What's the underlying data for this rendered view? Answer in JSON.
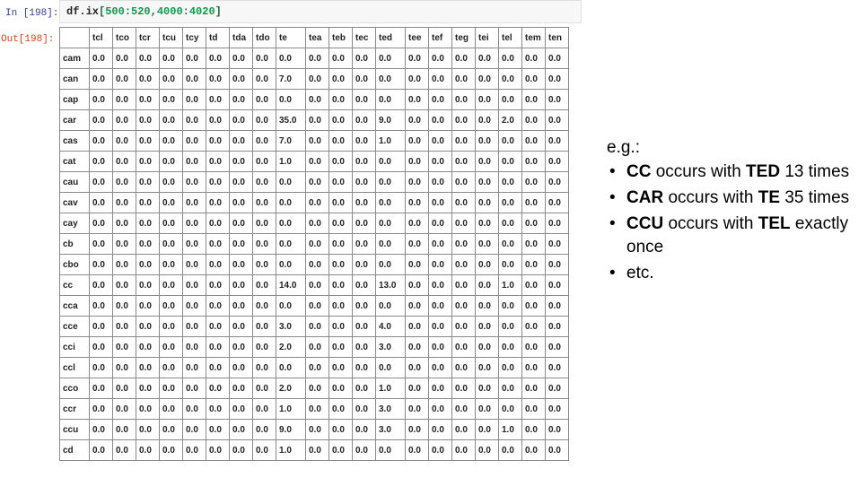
{
  "notebook": {
    "in_prompt": "In [198]:",
    "out_prompt": "Out[198]:",
    "code": {
      "object": "df.ix",
      "open_bracket": "[",
      "row_start": "500",
      "colon1": ":",
      "row_end": "520",
      "comma": ",",
      "col_start": "4000",
      "colon2": ":",
      "col_end": "4020",
      "close_bracket": "]"
    },
    "code_full": "df.ix[500:520,4000:4020]"
  },
  "table": {
    "corner_label": "",
    "columns": [
      "tcl",
      "tco",
      "tcr",
      "tcu",
      "tcy",
      "td",
      "tda",
      "tdo",
      "te",
      "tea",
      "teb",
      "tec",
      "ted",
      "tee",
      "tef",
      "teg",
      "tei",
      "tel",
      "tem",
      "ten"
    ],
    "index": [
      "cam",
      "can",
      "cap",
      "car",
      "cas",
      "cat",
      "cau",
      "cav",
      "cay",
      "cb",
      "cbo",
      "cc",
      "cca",
      "cce",
      "cci",
      "ccl",
      "cco",
      "ccr",
      "ccu",
      "cd"
    ],
    "rows": [
      {
        "index": "cam",
        "values": [
          "0.0",
          "0.0",
          "0.0",
          "0.0",
          "0.0",
          "0.0",
          "0.0",
          "0.0",
          "0.0",
          "0.0",
          "0.0",
          "0.0",
          "0.0",
          "0.0",
          "0.0",
          "0.0",
          "0.0",
          "0.0",
          "0.0",
          "0.0"
        ]
      },
      {
        "index": "can",
        "values": [
          "0.0",
          "0.0",
          "0.0",
          "0.0",
          "0.0",
          "0.0",
          "0.0",
          "0.0",
          "7.0",
          "0.0",
          "0.0",
          "0.0",
          "0.0",
          "0.0",
          "0.0",
          "0.0",
          "0.0",
          "0.0",
          "0.0",
          "0.0"
        ]
      },
      {
        "index": "cap",
        "values": [
          "0.0",
          "0.0",
          "0.0",
          "0.0",
          "0.0",
          "0.0",
          "0.0",
          "0.0",
          "0.0",
          "0.0",
          "0.0",
          "0.0",
          "0.0",
          "0.0",
          "0.0",
          "0.0",
          "0.0",
          "0.0",
          "0.0",
          "0.0"
        ]
      },
      {
        "index": "car",
        "values": [
          "0.0",
          "0.0",
          "0.0",
          "0.0",
          "0.0",
          "0.0",
          "0.0",
          "0.0",
          "35.0",
          "0.0",
          "0.0",
          "0.0",
          "9.0",
          "0.0",
          "0.0",
          "0.0",
          "0.0",
          "2.0",
          "0.0",
          "0.0"
        ]
      },
      {
        "index": "cas",
        "values": [
          "0.0",
          "0.0",
          "0.0",
          "0.0",
          "0.0",
          "0.0",
          "0.0",
          "0.0",
          "7.0",
          "0.0",
          "0.0",
          "0.0",
          "1.0",
          "0.0",
          "0.0",
          "0.0",
          "0.0",
          "0.0",
          "0.0",
          "0.0"
        ]
      },
      {
        "index": "cat",
        "values": [
          "0.0",
          "0.0",
          "0.0",
          "0.0",
          "0.0",
          "0.0",
          "0.0",
          "0.0",
          "1.0",
          "0.0",
          "0.0",
          "0.0",
          "0.0",
          "0.0",
          "0.0",
          "0.0",
          "0.0",
          "0.0",
          "0.0",
          "0.0"
        ]
      },
      {
        "index": "cau",
        "values": [
          "0.0",
          "0.0",
          "0.0",
          "0.0",
          "0.0",
          "0.0",
          "0.0",
          "0.0",
          "0.0",
          "0.0",
          "0.0",
          "0.0",
          "0.0",
          "0.0",
          "0.0",
          "0.0",
          "0.0",
          "0.0",
          "0.0",
          "0.0"
        ]
      },
      {
        "index": "cav",
        "values": [
          "0.0",
          "0.0",
          "0.0",
          "0.0",
          "0.0",
          "0.0",
          "0.0",
          "0.0",
          "0.0",
          "0.0",
          "0.0",
          "0.0",
          "0.0",
          "0.0",
          "0.0",
          "0.0",
          "0.0",
          "0.0",
          "0.0",
          "0.0"
        ]
      },
      {
        "index": "cay",
        "values": [
          "0.0",
          "0.0",
          "0.0",
          "0.0",
          "0.0",
          "0.0",
          "0.0",
          "0.0",
          "0.0",
          "0.0",
          "0.0",
          "0.0",
          "0.0",
          "0.0",
          "0.0",
          "0.0",
          "0.0",
          "0.0",
          "0.0",
          "0.0"
        ]
      },
      {
        "index": "cb",
        "values": [
          "0.0",
          "0.0",
          "0.0",
          "0.0",
          "0.0",
          "0.0",
          "0.0",
          "0.0",
          "0.0",
          "0.0",
          "0.0",
          "0.0",
          "0.0",
          "0.0",
          "0.0",
          "0.0",
          "0.0",
          "0.0",
          "0.0",
          "0.0"
        ]
      },
      {
        "index": "cbo",
        "values": [
          "0.0",
          "0.0",
          "0.0",
          "0.0",
          "0.0",
          "0.0",
          "0.0",
          "0.0",
          "0.0",
          "0.0",
          "0.0",
          "0.0",
          "0.0",
          "0.0",
          "0.0",
          "0.0",
          "0.0",
          "0.0",
          "0.0",
          "0.0"
        ]
      },
      {
        "index": "cc",
        "values": [
          "0.0",
          "0.0",
          "0.0",
          "0.0",
          "0.0",
          "0.0",
          "0.0",
          "0.0",
          "14.0",
          "0.0",
          "0.0",
          "0.0",
          "13.0",
          "0.0",
          "0.0",
          "0.0",
          "0.0",
          "1.0",
          "0.0",
          "0.0"
        ]
      },
      {
        "index": "cca",
        "values": [
          "0.0",
          "0.0",
          "0.0",
          "0.0",
          "0.0",
          "0.0",
          "0.0",
          "0.0",
          "0.0",
          "0.0",
          "0.0",
          "0.0",
          "0.0",
          "0.0",
          "0.0",
          "0.0",
          "0.0",
          "0.0",
          "0.0",
          "0.0"
        ]
      },
      {
        "index": "cce",
        "values": [
          "0.0",
          "0.0",
          "0.0",
          "0.0",
          "0.0",
          "0.0",
          "0.0",
          "0.0",
          "3.0",
          "0.0",
          "0.0",
          "0.0",
          "4.0",
          "0.0",
          "0.0",
          "0.0",
          "0.0",
          "0.0",
          "0.0",
          "0.0"
        ]
      },
      {
        "index": "cci",
        "values": [
          "0.0",
          "0.0",
          "0.0",
          "0.0",
          "0.0",
          "0.0",
          "0.0",
          "0.0",
          "2.0",
          "0.0",
          "0.0",
          "0.0",
          "3.0",
          "0.0",
          "0.0",
          "0.0",
          "0.0",
          "0.0",
          "0.0",
          "0.0"
        ]
      },
      {
        "index": "ccl",
        "values": [
          "0.0",
          "0.0",
          "0.0",
          "0.0",
          "0.0",
          "0.0",
          "0.0",
          "0.0",
          "0.0",
          "0.0",
          "0.0",
          "0.0",
          "0.0",
          "0.0",
          "0.0",
          "0.0",
          "0.0",
          "0.0",
          "0.0",
          "0.0"
        ]
      },
      {
        "index": "cco",
        "values": [
          "0.0",
          "0.0",
          "0.0",
          "0.0",
          "0.0",
          "0.0",
          "0.0",
          "0.0",
          "2.0",
          "0.0",
          "0.0",
          "0.0",
          "1.0",
          "0.0",
          "0.0",
          "0.0",
          "0.0",
          "0.0",
          "0.0",
          "0.0"
        ]
      },
      {
        "index": "ccr",
        "values": [
          "0.0",
          "0.0",
          "0.0",
          "0.0",
          "0.0",
          "0.0",
          "0.0",
          "0.0",
          "1.0",
          "0.0",
          "0.0",
          "0.0",
          "3.0",
          "0.0",
          "0.0",
          "0.0",
          "0.0",
          "0.0",
          "0.0",
          "0.0"
        ]
      },
      {
        "index": "ccu",
        "values": [
          "0.0",
          "0.0",
          "0.0",
          "0.0",
          "0.0",
          "0.0",
          "0.0",
          "0.0",
          "9.0",
          "0.0",
          "0.0",
          "0.0",
          "3.0",
          "0.0",
          "0.0",
          "0.0",
          "0.0",
          "1.0",
          "0.0",
          "0.0"
        ]
      },
      {
        "index": "cd",
        "values": [
          "0.0",
          "0.0",
          "0.0",
          "0.0",
          "0.0",
          "0.0",
          "0.0",
          "0.0",
          "1.0",
          "0.0",
          "0.0",
          "0.0",
          "0.0",
          "0.0",
          "0.0",
          "0.0",
          "0.0",
          "0.0",
          "0.0",
          "0.0"
        ]
      }
    ]
  },
  "notes": {
    "heading": "e.g.:",
    "bullet_glyph": "•",
    "items": [
      {
        "parts": [
          {
            "text": "CC",
            "bold": true
          },
          {
            "text": " occurs with ",
            "bold": false
          },
          {
            "text": "TED",
            "bold": true
          },
          {
            "text": " 13 times",
            "bold": false
          }
        ]
      },
      {
        "parts": [
          {
            "text": "CAR",
            "bold": true
          },
          {
            "text": " occurs with ",
            "bold": false
          },
          {
            "text": "TE",
            "bold": true
          },
          {
            "text": " 35 times",
            "bold": false
          }
        ]
      },
      {
        "parts": [
          {
            "text": "CCU",
            "bold": true
          },
          {
            "text": " occurs with ",
            "bold": false
          },
          {
            "text": "TEL",
            "bold": true
          },
          {
            "text": " exactly once",
            "bold": false
          }
        ]
      },
      {
        "parts": [
          {
            "text": "etc.",
            "bold": false
          }
        ]
      }
    ]
  },
  "colors": {
    "in_prompt": "#303f9f",
    "out_prompt": "#d84315",
    "code_number": "#0a9b4b",
    "code_text": "#202020",
    "input_bg": "#f7f7f7",
    "table_border": "#8a8a8a",
    "page_bg": "#ffffff"
  }
}
